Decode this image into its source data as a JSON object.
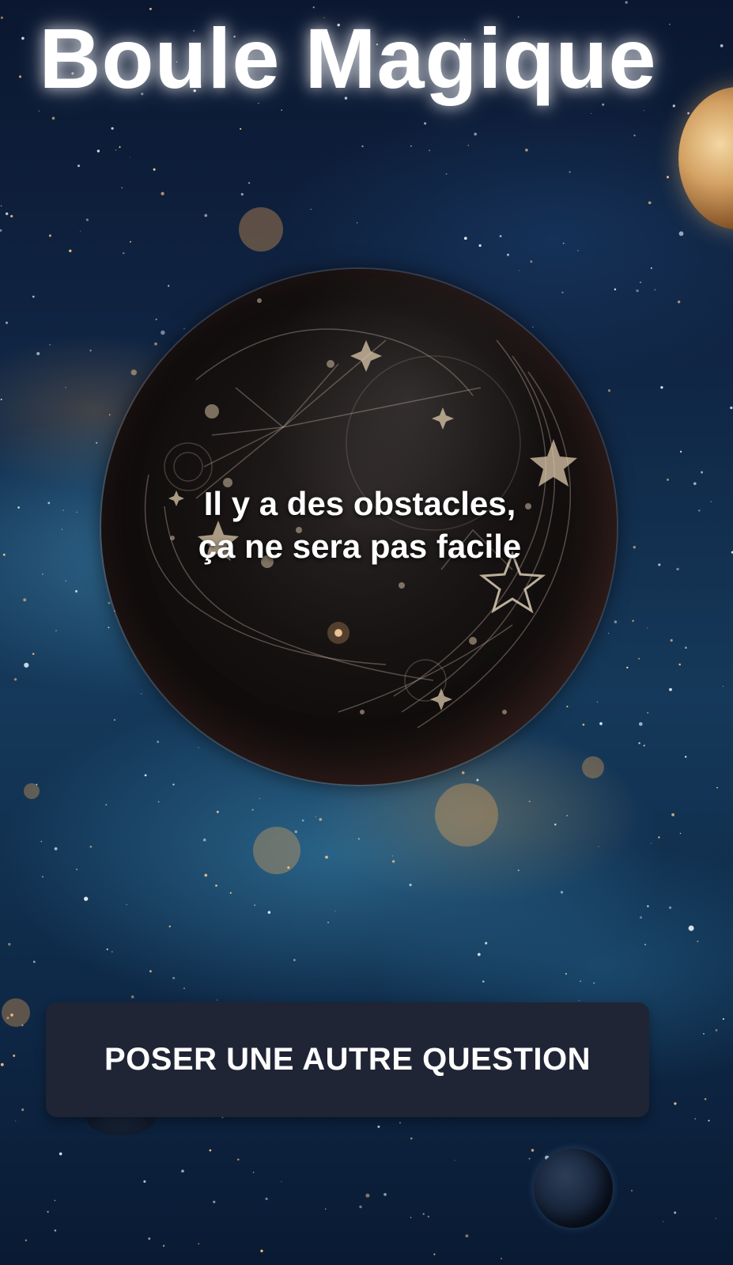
{
  "app": {
    "title": "Boule Magique"
  },
  "ball": {
    "answer_line1": "Il y a des obstacles,",
    "answer_line2": "ça ne sera pas facile"
  },
  "actions": {
    "ask_again_label": "POSER UNE AUTRE QUESTION"
  },
  "colors": {
    "button_background": "#1f2535",
    "title_text": "#ffffff",
    "space_background": "#102645"
  }
}
